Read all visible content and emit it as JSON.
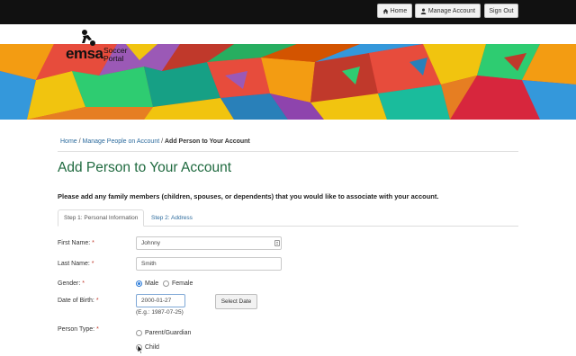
{
  "topnav": {
    "home_label": "Home",
    "manage_label": "Manage Account",
    "signout_label": "Sign Out"
  },
  "logo": {
    "wordmark": "emsa",
    "portal_line1": "Soccer",
    "portal_line2": "Portal"
  },
  "breadcrumb": {
    "home": "Home",
    "sep1": " / ",
    "manage": "Manage People on Account",
    "sep2": " / ",
    "current": "Add Person to Your Account"
  },
  "page_title": "Add Person to Your Account",
  "intro": "Please add any family members (children, spouses, or dependents) that you would like to associate with your account.",
  "tabs": [
    {
      "label": "Step 1: Personal Information",
      "active": true
    },
    {
      "label": "Step 2: Address",
      "active": false
    }
  ],
  "form": {
    "first_name": {
      "label": "First Name:",
      "required_mark": "*",
      "value": "Johnny"
    },
    "last_name": {
      "label": "Last Name:",
      "required_mark": "*",
      "value": "Smith"
    },
    "gender": {
      "label": "Gender:",
      "required_mark": "*",
      "options": [
        "Male",
        "Female"
      ],
      "selected": "Male"
    },
    "dob": {
      "label": "Date of Birth:",
      "required_mark": "*",
      "value": "2000-01-27",
      "hint": "(E.g.: 1987-07-25)",
      "button": "Select Date"
    },
    "person_type": {
      "label": "Person Type:",
      "required_mark": "*",
      "options": [
        "Parent/Guardian",
        "Child"
      ],
      "selected": ""
    }
  },
  "colors": {
    "topbar": "#111111",
    "title_green": "#1f6a3f",
    "link_blue": "#2e6c9e",
    "required_red": "#c0392b",
    "radio_blue": "#2a7ad8"
  }
}
